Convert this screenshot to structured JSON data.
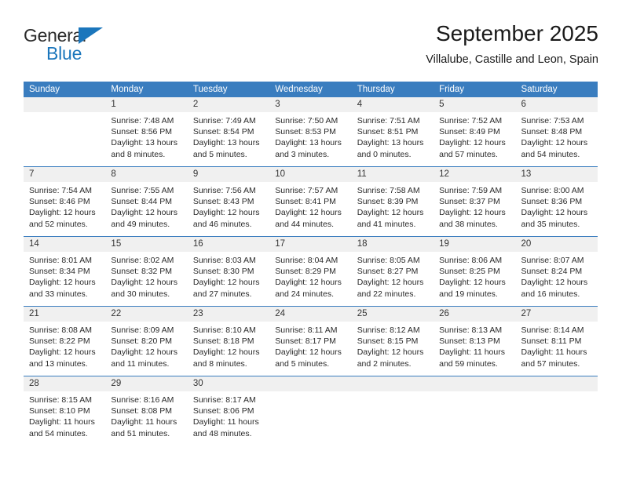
{
  "brand": {
    "name_top": "General",
    "name_bottom": "Blue",
    "accent_color": "#1b76bc"
  },
  "header": {
    "title": "September 2025",
    "subtitle": "Villalube, Castille and Leon, Spain"
  },
  "theme": {
    "header_row_bg": "#3a7dbf",
    "daynum_bg": "#f0f0f0",
    "text_color": "#2a2a2a"
  },
  "weekday_headers": [
    "Sunday",
    "Monday",
    "Tuesday",
    "Wednesday",
    "Thursday",
    "Friday",
    "Saturday"
  ],
  "weeks": [
    [
      {
        "day": "",
        "lines": []
      },
      {
        "day": "1",
        "lines": [
          "Sunrise: 7:48 AM",
          "Sunset: 8:56 PM",
          "Daylight: 13 hours",
          "and 8 minutes."
        ]
      },
      {
        "day": "2",
        "lines": [
          "Sunrise: 7:49 AM",
          "Sunset: 8:54 PM",
          "Daylight: 13 hours",
          "and 5 minutes."
        ]
      },
      {
        "day": "3",
        "lines": [
          "Sunrise: 7:50 AM",
          "Sunset: 8:53 PM",
          "Daylight: 13 hours",
          "and 3 minutes."
        ]
      },
      {
        "day": "4",
        "lines": [
          "Sunrise: 7:51 AM",
          "Sunset: 8:51 PM",
          "Daylight: 13 hours",
          "and 0 minutes."
        ]
      },
      {
        "day": "5",
        "lines": [
          "Sunrise: 7:52 AM",
          "Sunset: 8:49 PM",
          "Daylight: 12 hours",
          "and 57 minutes."
        ]
      },
      {
        "day": "6",
        "lines": [
          "Sunrise: 7:53 AM",
          "Sunset: 8:48 PM",
          "Daylight: 12 hours",
          "and 54 minutes."
        ]
      }
    ],
    [
      {
        "day": "7",
        "lines": [
          "Sunrise: 7:54 AM",
          "Sunset: 8:46 PM",
          "Daylight: 12 hours",
          "and 52 minutes."
        ]
      },
      {
        "day": "8",
        "lines": [
          "Sunrise: 7:55 AM",
          "Sunset: 8:44 PM",
          "Daylight: 12 hours",
          "and 49 minutes."
        ]
      },
      {
        "day": "9",
        "lines": [
          "Sunrise: 7:56 AM",
          "Sunset: 8:43 PM",
          "Daylight: 12 hours",
          "and 46 minutes."
        ]
      },
      {
        "day": "10",
        "lines": [
          "Sunrise: 7:57 AM",
          "Sunset: 8:41 PM",
          "Daylight: 12 hours",
          "and 44 minutes."
        ]
      },
      {
        "day": "11",
        "lines": [
          "Sunrise: 7:58 AM",
          "Sunset: 8:39 PM",
          "Daylight: 12 hours",
          "and 41 minutes."
        ]
      },
      {
        "day": "12",
        "lines": [
          "Sunrise: 7:59 AM",
          "Sunset: 8:37 PM",
          "Daylight: 12 hours",
          "and 38 minutes."
        ]
      },
      {
        "day": "13",
        "lines": [
          "Sunrise: 8:00 AM",
          "Sunset: 8:36 PM",
          "Daylight: 12 hours",
          "and 35 minutes."
        ]
      }
    ],
    [
      {
        "day": "14",
        "lines": [
          "Sunrise: 8:01 AM",
          "Sunset: 8:34 PM",
          "Daylight: 12 hours",
          "and 33 minutes."
        ]
      },
      {
        "day": "15",
        "lines": [
          "Sunrise: 8:02 AM",
          "Sunset: 8:32 PM",
          "Daylight: 12 hours",
          "and 30 minutes."
        ]
      },
      {
        "day": "16",
        "lines": [
          "Sunrise: 8:03 AM",
          "Sunset: 8:30 PM",
          "Daylight: 12 hours",
          "and 27 minutes."
        ]
      },
      {
        "day": "17",
        "lines": [
          "Sunrise: 8:04 AM",
          "Sunset: 8:29 PM",
          "Daylight: 12 hours",
          "and 24 minutes."
        ]
      },
      {
        "day": "18",
        "lines": [
          "Sunrise: 8:05 AM",
          "Sunset: 8:27 PM",
          "Daylight: 12 hours",
          "and 22 minutes."
        ]
      },
      {
        "day": "19",
        "lines": [
          "Sunrise: 8:06 AM",
          "Sunset: 8:25 PM",
          "Daylight: 12 hours",
          "and 19 minutes."
        ]
      },
      {
        "day": "20",
        "lines": [
          "Sunrise: 8:07 AM",
          "Sunset: 8:24 PM",
          "Daylight: 12 hours",
          "and 16 minutes."
        ]
      }
    ],
    [
      {
        "day": "21",
        "lines": [
          "Sunrise: 8:08 AM",
          "Sunset: 8:22 PM",
          "Daylight: 12 hours",
          "and 13 minutes."
        ]
      },
      {
        "day": "22",
        "lines": [
          "Sunrise: 8:09 AM",
          "Sunset: 8:20 PM",
          "Daylight: 12 hours",
          "and 11 minutes."
        ]
      },
      {
        "day": "23",
        "lines": [
          "Sunrise: 8:10 AM",
          "Sunset: 8:18 PM",
          "Daylight: 12 hours",
          "and 8 minutes."
        ]
      },
      {
        "day": "24",
        "lines": [
          "Sunrise: 8:11 AM",
          "Sunset: 8:17 PM",
          "Daylight: 12 hours",
          "and 5 minutes."
        ]
      },
      {
        "day": "25",
        "lines": [
          "Sunrise: 8:12 AM",
          "Sunset: 8:15 PM",
          "Daylight: 12 hours",
          "and 2 minutes."
        ]
      },
      {
        "day": "26",
        "lines": [
          "Sunrise: 8:13 AM",
          "Sunset: 8:13 PM",
          "Daylight: 11 hours",
          "and 59 minutes."
        ]
      },
      {
        "day": "27",
        "lines": [
          "Sunrise: 8:14 AM",
          "Sunset: 8:11 PM",
          "Daylight: 11 hours",
          "and 57 minutes."
        ]
      }
    ],
    [
      {
        "day": "28",
        "lines": [
          "Sunrise: 8:15 AM",
          "Sunset: 8:10 PM",
          "Daylight: 11 hours",
          "and 54 minutes."
        ]
      },
      {
        "day": "29",
        "lines": [
          "Sunrise: 8:16 AM",
          "Sunset: 8:08 PM",
          "Daylight: 11 hours",
          "and 51 minutes."
        ]
      },
      {
        "day": "30",
        "lines": [
          "Sunrise: 8:17 AM",
          "Sunset: 8:06 PM",
          "Daylight: 11 hours",
          "and 48 minutes."
        ]
      },
      {
        "day": "",
        "lines": []
      },
      {
        "day": "",
        "lines": []
      },
      {
        "day": "",
        "lines": []
      },
      {
        "day": "",
        "lines": []
      }
    ]
  ]
}
